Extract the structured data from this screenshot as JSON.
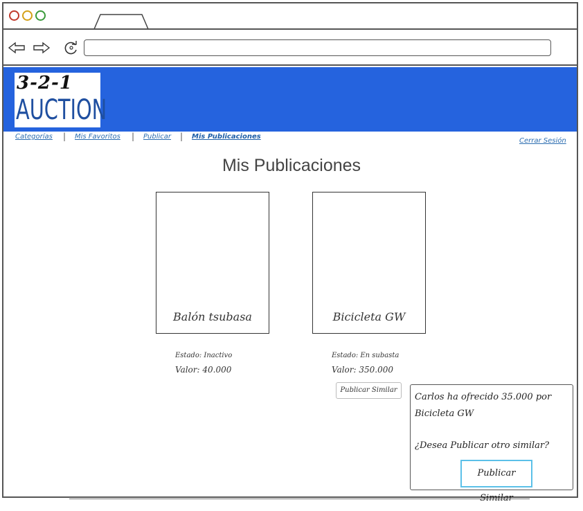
{
  "logo": {
    "top": "3-2-1",
    "bottom": "AUCTION"
  },
  "nav": {
    "items": [
      {
        "label": "Categorías"
      },
      {
        "label": "Mis Favoritos"
      },
      {
        "label": "Publicar"
      },
      {
        "label": "Mis Publicaciones",
        "active": true
      }
    ],
    "logout": "Cerrar Sesión"
  },
  "page": {
    "title": "Mis Publicaciones"
  },
  "products": [
    {
      "name": "Balón tsubasa",
      "estado": "Estado: Inactivo",
      "valor": "Valor: 40.000"
    },
    {
      "name": "Bicicleta GW",
      "estado": "Estado: En subasta",
      "valor": "Valor: 350.000",
      "action": "Publicar Similar"
    }
  ],
  "popup": {
    "message": "Carlos ha ofrecido 35.000 por Bicicleta GW",
    "question": "¿Desea Publicar otro similar?",
    "button": "Publicar Similar"
  },
  "colors": {
    "banner": "#2563de",
    "link": "#2a6cb0",
    "accent": "#5bc0e8"
  }
}
